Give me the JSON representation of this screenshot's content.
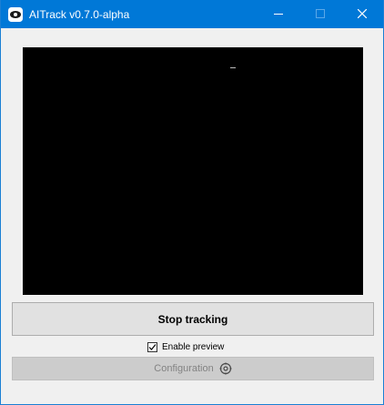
{
  "window": {
    "title": "AITrack v0.7.0-alpha",
    "app_icon": "eye-icon",
    "controls": {
      "minimize_icon": "minimize-icon",
      "maximize_icon": "maximize-icon",
      "close_icon": "close-icon"
    }
  },
  "main": {
    "stop_tracking_label": "Stop tracking",
    "enable_preview": {
      "label": "Enable preview",
      "checked": true
    },
    "configuration_label": "Configuration",
    "configuration_icon": "gear-icon",
    "configuration_enabled": false
  },
  "colors": {
    "titlebar": "#0078d7",
    "preview_background": "#000000"
  }
}
